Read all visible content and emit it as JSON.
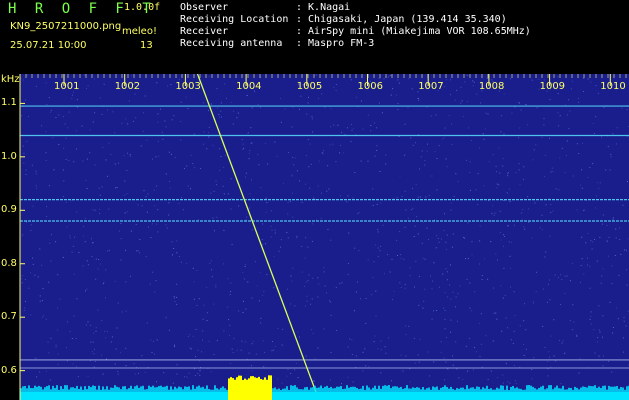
{
  "header": {
    "brand": "H R O F F T",
    "version": "1.0.0f",
    "filename": "KN9_2507211000.png",
    "meleo_label": "meleo!",
    "datetime": "25.07.21 10:00",
    "count": "13",
    "info": [
      {
        "label": "Observer",
        "value": ": K.Nagai"
      },
      {
        "label": "Receiving Location",
        "value": ": Chigasaki, Japan (139.414 35.340)"
      },
      {
        "label": "Receiver",
        "value": ": AirSpy mini (Miakejima VOR 108.65MHz)"
      },
      {
        "label": "Receiving antenna",
        "value": ": Maspro FM-3"
      }
    ]
  },
  "chart_data": {
    "type": "heatmap",
    "y_unit": "kHz",
    "x_ticks": [
      "1001",
      "1002",
      "1003",
      "1004",
      "1005",
      "1006",
      "1007",
      "1008",
      "1009",
      "1010"
    ],
    "y_ticks": [
      "1.1",
      "1.0",
      "0.9",
      "0.8",
      "0.7",
      "0.6"
    ],
    "ylim": [
      0.575,
      1.155
    ],
    "horizontal_lines_khz": [
      1.095,
      1.04,
      0.92,
      0.88,
      0.62,
      0.605
    ],
    "meteor_trace": {
      "x_start": 1003.2,
      "y_start": 1.155,
      "x_end": 1005.2,
      "y_end": 0.575
    },
    "colors": {
      "background": "#1a1e8c",
      "noise": "#5a78e6",
      "trace": "#d8ff5a",
      "carrier": "#58e0ff",
      "axis_text": "#ffff66",
      "baseline": "#00e5ff",
      "burst": "#ffff00"
    }
  }
}
